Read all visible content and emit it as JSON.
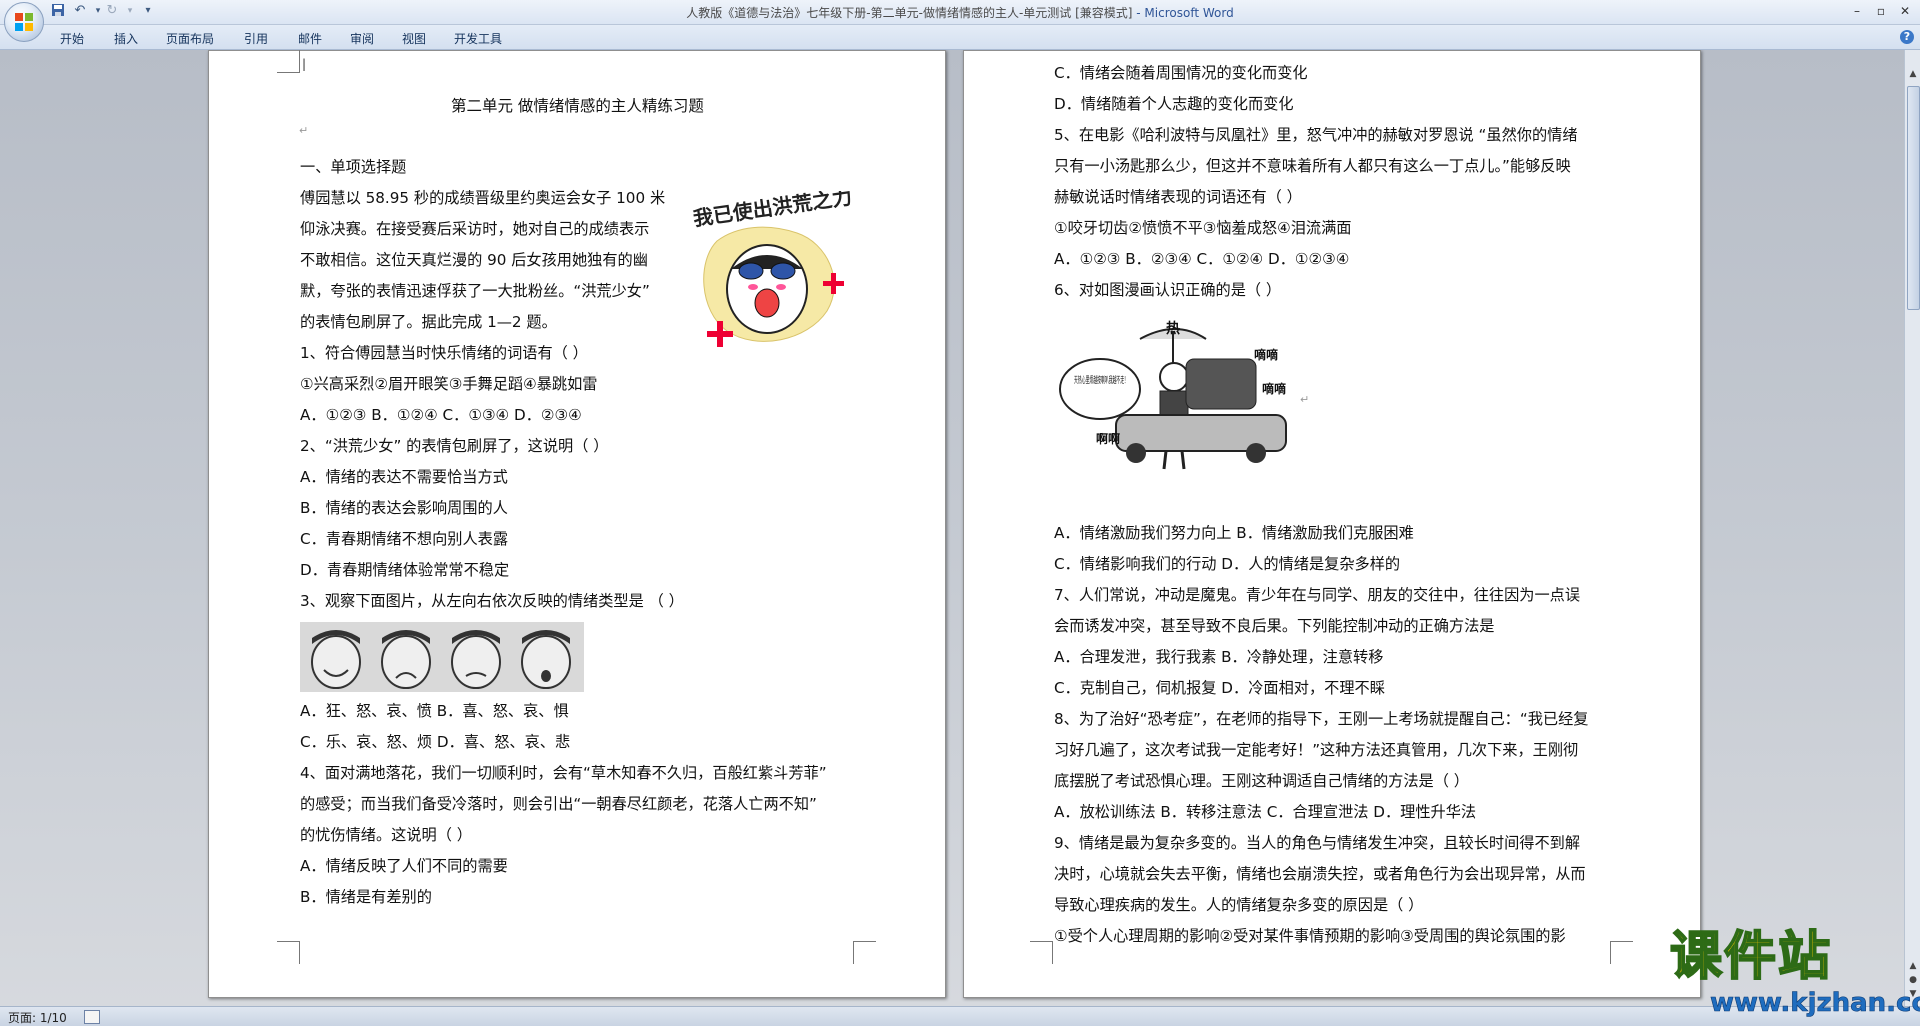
{
  "window": {
    "title": "人教版《道德与法治》七年级下册-第二单元-做情绪情感的主人-单元测试 [兼容模式]",
    "app_name": " - Microsoft Word"
  },
  "quick_access": [
    "save-icon",
    "undo-icon",
    "redo-icon",
    "customize-icon"
  ],
  "ribbon_tabs": [
    "开始",
    "插入",
    "页面布局",
    "引用",
    "邮件",
    "审阅",
    "视图",
    "开发工具"
  ],
  "page1": {
    "lines": [
      "第二单元  做情绪情感的主人精练习题",
      "一、单项选择题",
      "傅园慧以 58.95 秒的成绩晋级里约奥运会女子 100 米",
      "仰泳决赛。在接受赛后采访时，她对自己的成绩表示",
      "不敢相信。这位天真烂漫的 90 后女孩用她独有的幽",
      "默，夸张的表情迅速俘获了一大批粉丝。“洪荒少女”",
      "的表情包刷屏了。据此完成 1—2 题。",
      "1、符合傅园慧当时快乐情绪的词语有（    ）",
      "①兴高采烈②眉开眼笑③手舞足蹈④暴跳如雷",
      "A．①②③    B．①②④    C．①③④    D．②③④",
      "2、“洪荒少女” 的表情包刷屏了，这说明（    ）",
      "A．情绪的表达不需要恰当方式",
      "B．情绪的表达会影响周围的人",
      "C．青春期情绪不想向别人表露",
      "D．青春期情绪体验常常不稳定",
      "3、观察下面图片，从左向右依次反映的情绪类型是     （    ）",
      "A．狂、怒、哀、愤    B．喜、怒、哀、惧",
      "C．乐、哀、怒、烦    D．喜、怒、哀、悲",
      "4、面对满地落花，我们一切顺利时，会有“草木知春不久归，百般红紫斗芳菲”",
      "的感受；而当我们备受冷落时，则会引出“一朝春尽红颜老，花落人亡两不知”",
      "的忧伤情绪。这说明（    ）",
      "A．情绪反映了人们不同的需要",
      "B．情绪是有差别的"
    ],
    "meme_caption": "我已使出洪荒之力！"
  },
  "page2": {
    "lines": [
      "C．情绪会随着周围情况的变化而变化",
      "D．情绪随着个人志趣的变化而变化",
      "5、在电影《哈利波特与凤凰社》里，怒气冲冲的赫敏对罗恩说 “虽然你的情绪",
      "只有一小汤匙那么少，但这并不意味着所有人都只有这么一丁点儿。”能够反映",
      "赫敏说话时情绪表现的词语还有（    ）",
      "①咬牙切齿②愤愤不平③恼羞成怒④泪流满面",
      "A．①②③  B．②③④  C．①②④    D．①②③④",
      "6、对如图漫画认识正确的是（    ）",
      "A．情绪激励我们努力向上 B．情绪激励我们克服困难",
      "C．情绪影响我们的行动      D．人的情绪是复杂多样的",
      "7、人们常说，冲动是魔鬼。青少年在与同学、朋友的交往中，往往因为一点误",
      "会而诱发冲突，甚至导致不良后果。下列能控制冲动的正确方法是",
      "A．合理发泄，我行我素        B．冷静处理，注意转移",
      "C．克制自己，伺机报复        D．冷面相对，不理不睬",
      "8、为了治好“恐考症”，在老师的指导下，王刚一上考场就提醒自己：“我已经复",
      "习好几遍了，这次考试我一定能考好！”这种方法还真管用，几次下来，王刚彻",
      "底摆脱了考试恐惧心理。王刚这种调适自己情绪的方法是（      ）",
      "A．放松训练法    B．转移注意法    C．合理宣泄法    D．理性升华法",
      "9、情绪是最为复杂多变的。当人的角色与情绪发生冲突，且较长时间得不到解",
      "决时，心境就会失去平衡，情绪也会崩溃失控，或者角色行为会出现异常，从而",
      "导致心理疾病的发生。人的情绪复杂多变的原因是（    ）",
      "①受个人心理周期的影响②受对某件事情预期的影响③受周围的舆论氛围的影"
    ],
    "cartoon_bubble": "天热心里烦越按喇叭我越不走！",
    "cartoon_labels": [
      "热",
      "嘀嘀",
      "嘀嘀",
      "啊啊"
    ]
  },
  "status": {
    "page": "页面: 1/10"
  },
  "watermark": {
    "main": "课件站",
    "url": "www.kjzhan.com"
  }
}
